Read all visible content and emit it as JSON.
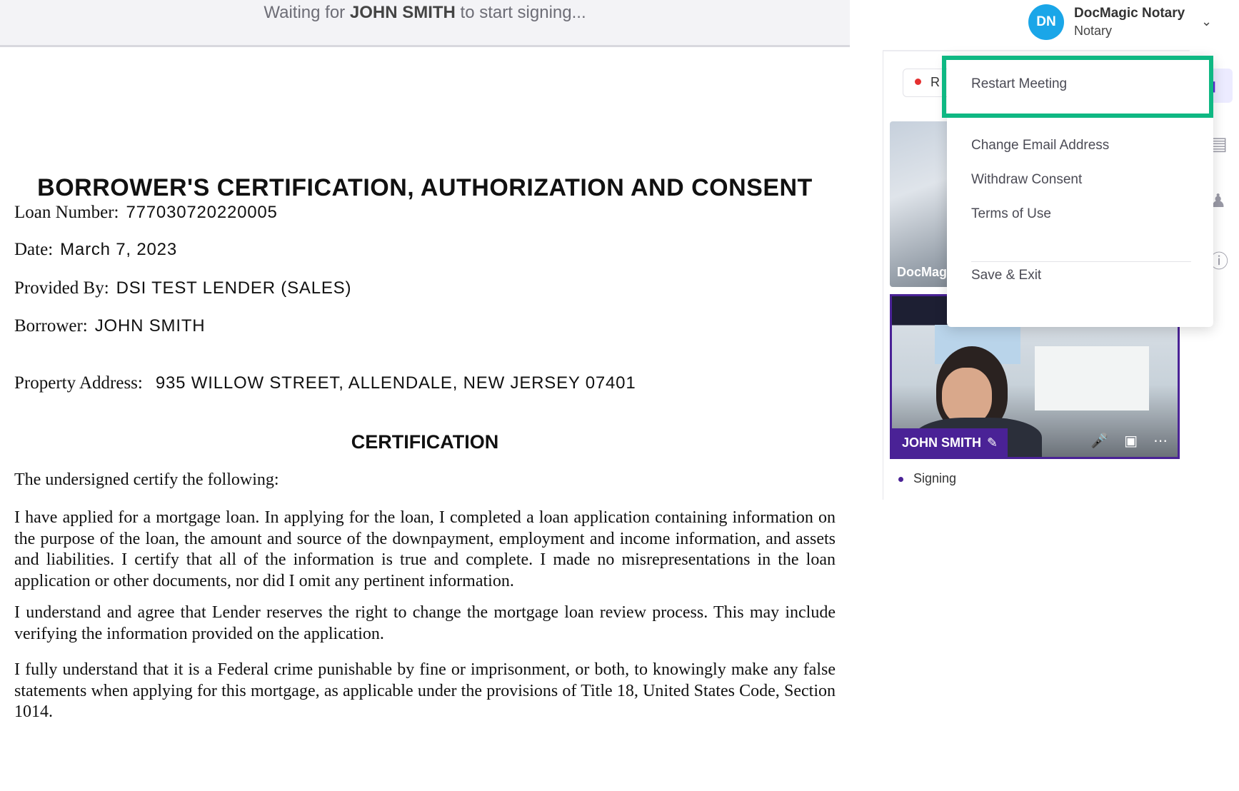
{
  "banner": {
    "prefix": "Waiting for",
    "name": "JOHN SMITH",
    "suffix": "to start signing..."
  },
  "document": {
    "title": "BORROWER'S CERTIFICATION, AUTHORIZATION AND CONSENT",
    "fields": [
      {
        "label": "Loan Number:",
        "value": "777030720220005"
      },
      {
        "label": "Date:",
        "value": "March 7, 2023"
      },
      {
        "label": "Provided By:",
        "value": "DSI TEST LENDER (SALES)"
      },
      {
        "label": "Borrower:",
        "value": "JOHN SMITH"
      },
      {
        "label": "Property Address:",
        "value": "935 WILLOW STREET, ALLENDALE, NEW JERSEY 07401"
      }
    ],
    "section_heading": "CERTIFICATION",
    "paragraphs": [
      "The undersigned certify the following:",
      "I have applied for a mortgage loan. In applying for the loan, I completed a loan application containing information on the purpose of the loan, the amount and source of the downpayment, employment and income information, and assets and liabilities. I certify that all of the information is true and complete. I made no misrepresentations in the loan application or other documents, nor did I omit any pertinent information.",
      "I understand and agree that Lender reserves the right to change the mortgage loan review process. This may include verifying the information provided on the application.",
      "I fully understand that it is a Federal crime punishable by fine or imprisonment, or both, to knowingly make any false statements when applying for this mortgage, as applicable under the provisions of Title 18, United States Code, Section 1014."
    ]
  },
  "profile": {
    "initials": "DN",
    "name": "DocMagic Notary",
    "role": "Notary",
    "avatar_color": "#1aa6e8",
    "chevron_icon": "chevron-down-icon"
  },
  "panel": {
    "record_label": "R",
    "tiles": [
      {
        "name": "DocMag"
      },
      {
        "name": "JOHN SMITH",
        "edit_icon": "pencil-icon"
      }
    ],
    "status": "Signing",
    "accent_color": "#4a2296"
  },
  "menu": {
    "items": [
      "Restart Meeting",
      "Change Email Address",
      "Withdraw Consent",
      "Terms of Use",
      "Save & Exit"
    ],
    "highlight_color": "#0fb883"
  }
}
